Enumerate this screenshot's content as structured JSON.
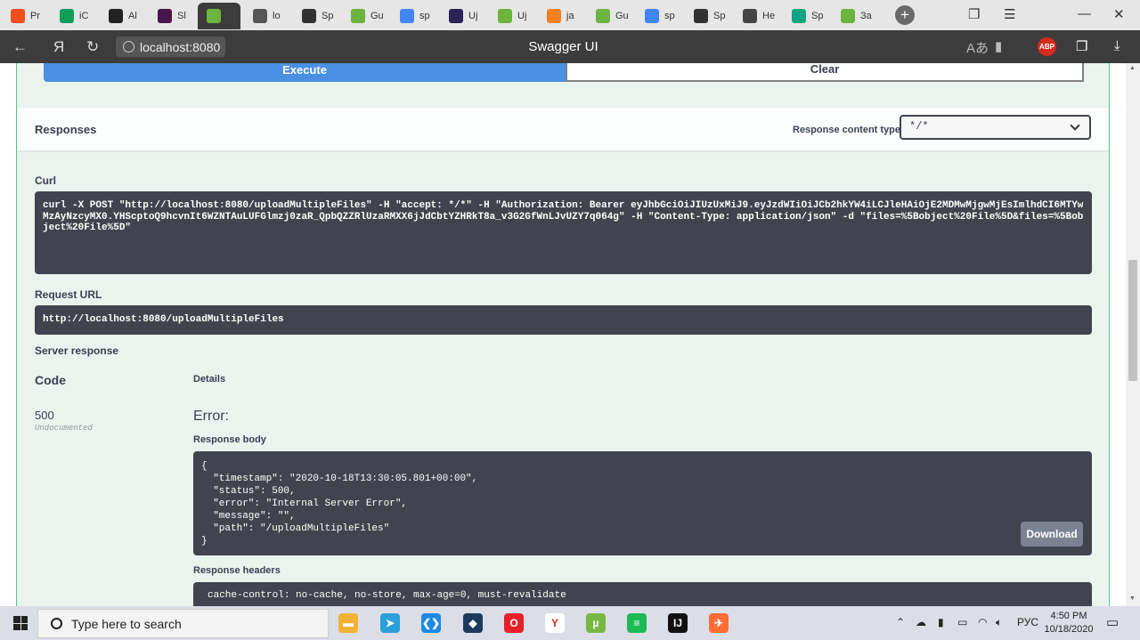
{
  "browser": {
    "tabs": [
      {
        "label": "Pr",
        "icon": "figma-icon",
        "color": "#f24e1e"
      },
      {
        "label": "iC",
        "icon": "sheets-icon",
        "color": "#0f9d58"
      },
      {
        "label": "Al",
        "icon": "github-icon",
        "color": "#222222"
      },
      {
        "label": "Sl",
        "icon": "slack-icon",
        "color": "#4a154b"
      },
      {
        "label": "",
        "icon": "spring-icon",
        "color": "#6db33f",
        "active": true
      },
      {
        "label": "lo",
        "icon": "page-icon",
        "color": "#555555"
      },
      {
        "label": "Sp",
        "icon": "swagger-icon",
        "color": "#333333"
      },
      {
        "label": "Gu",
        "icon": "spring-leaf-icon",
        "color": "#6db33f"
      },
      {
        "label": "sp",
        "icon": "google-icon",
        "color": "#4285f4"
      },
      {
        "label": "Uj",
        "icon": "eclipse-icon",
        "color": "#2c2255"
      },
      {
        "label": "Uj",
        "icon": "spring-leaf-icon",
        "color": "#6db33f"
      },
      {
        "label": "ja",
        "icon": "stackoverflow-icon",
        "color": "#f48024"
      },
      {
        "label": "Gu",
        "icon": "spring-icon",
        "color": "#6db33f"
      },
      {
        "label": "sp",
        "icon": "google-icon",
        "color": "#4285f4"
      },
      {
        "label": "Sp",
        "icon": "swagger-icon",
        "color": "#333333"
      },
      {
        "label": "He",
        "icon": "feather-icon",
        "color": "#444444"
      },
      {
        "label": "Sp",
        "icon": "green-circle-icon",
        "color": "#0fa37f"
      },
      {
        "label": "За",
        "icon": "spring-icon",
        "color": "#6db33f"
      }
    ],
    "address": "localhost:8080",
    "page_title": "Swagger UI",
    "back_icon": "arrow-left-icon",
    "yandex_icon": "Я",
    "reload_icon": "reload-icon",
    "abp_label": "ABP"
  },
  "swagger": {
    "execute_label": "Execute",
    "clear_label": "Clear",
    "responses_title": "Responses",
    "content_type_label": "Response content type",
    "content_type_value": "*/*",
    "curl_label": "Curl",
    "curl_command": "curl -X POST \"http://localhost:8080/uploadMultipleFiles\" -H \"accept: */*\" -H \"Authorization: Bearer eyJhbGciOiJIUzUxMiJ9.eyJzdWIiOiJCb2hkYW4iLCJleHAiOjE2MDMwMjgwMjEsImlhdCI6MTYwMzAyNzcyMX0.YHScptoQ9hcvnIt6WZNTAuLUFGlmzj0zaR_QpbQZZRlUzaRMXX6jJdCbtYZHRkT8a_v3G2GfWnLJvUZY7q064g\" -H \"Content-Type: application/json\" -d \"files=%5Bobject%20File%5D&files=%5Bobject%20File%5D\"",
    "request_url_label": "Request URL",
    "request_url": "http://localhost:8080/uploadMultipleFiles",
    "server_response_label": "Server response",
    "code_header": "Code",
    "details_header": "Details",
    "code": "500",
    "code_note": "Undocumented",
    "error_title": "Error:",
    "response_body_label": "Response body",
    "response_body": "{\n  \"timestamp\": \"2020-10-18T13:30:05.801+00:00\",\n  \"status\": 500,\n  \"error\": \"Internal Server Error\",\n  \"message\": \"\",\n  \"path\": \"/uploadMultipleFiles\"\n}",
    "download_label": "Download",
    "response_headers_label": "Response headers",
    "response_headers": "cache-control: no-cache, no-store, max-age=0, must-revalidate"
  },
  "taskbar": {
    "search_placeholder": "Type here to search",
    "language": "РУС",
    "time": "4:50 PM",
    "date": "10/18/2020",
    "apps": [
      {
        "icon": "file-explorer-icon",
        "color": "#f2b233",
        "glyph": "▬"
      },
      {
        "icon": "telegram-icon",
        "color": "#2aa0da",
        "glyph": "➤"
      },
      {
        "icon": "vscode-icon",
        "color": "#1e88e5",
        "glyph": "❮❯"
      },
      {
        "icon": "pycharm-icon",
        "color": "#1b3a5c",
        "glyph": "◆"
      },
      {
        "icon": "opera-icon",
        "color": "#e8202a",
        "glyph": "O"
      },
      {
        "icon": "yandex-browser-icon",
        "color": "#ffffff",
        "glyph": "Y"
      },
      {
        "icon": "utorrent-icon",
        "color": "#77b843",
        "glyph": "µ"
      },
      {
        "icon": "spotify-icon",
        "color": "#1db954",
        "glyph": "≡"
      },
      {
        "icon": "intellij-icon",
        "color": "#111111",
        "glyph": "IJ"
      },
      {
        "icon": "postman-icon",
        "color": "#ff6c37",
        "glyph": "✈"
      }
    ]
  }
}
